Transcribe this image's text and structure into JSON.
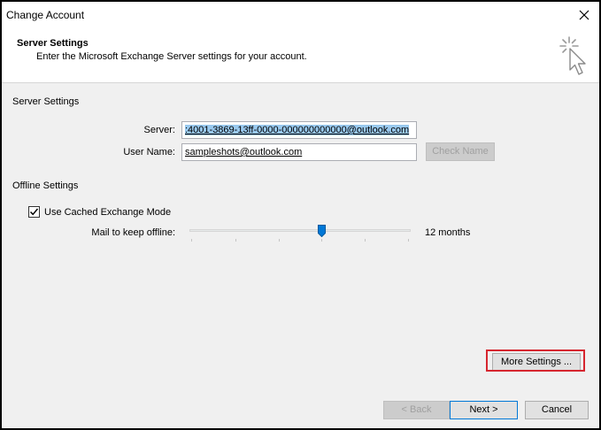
{
  "window": {
    "title": "Change Account"
  },
  "header": {
    "title": "Server Settings",
    "subtitle": "Enter the Microsoft Exchange Server settings for your account."
  },
  "server_settings": {
    "section_label": "Server Settings",
    "server_label": "Server:",
    "server_value": ":4001-3869-13ff-0000-000000000000@outlook.com",
    "username_label": "User Name:",
    "username_value": "sampleshots@outlook.com",
    "check_name_label": "Check Name"
  },
  "offline_settings": {
    "section_label": "Offline Settings",
    "cached_mode_label": "Use Cached Exchange Mode",
    "cached_mode_checked": true,
    "mail_offline_label": "Mail to keep offline:",
    "mail_offline_value": "12 months",
    "slider_position_fraction": 0.6
  },
  "buttons": {
    "more_settings": "More Settings ...",
    "back": "< Back",
    "next": "Next >",
    "cancel": "Cancel"
  },
  "colors": {
    "selection": "#99c9ef",
    "accent": "#0078d7",
    "highlight_box": "#d6262f"
  },
  "icons": {
    "close": "close-icon",
    "header": "cursor-click-icon",
    "checkbox": "checkmark-icon",
    "slider": "slider-thumb-icon"
  }
}
